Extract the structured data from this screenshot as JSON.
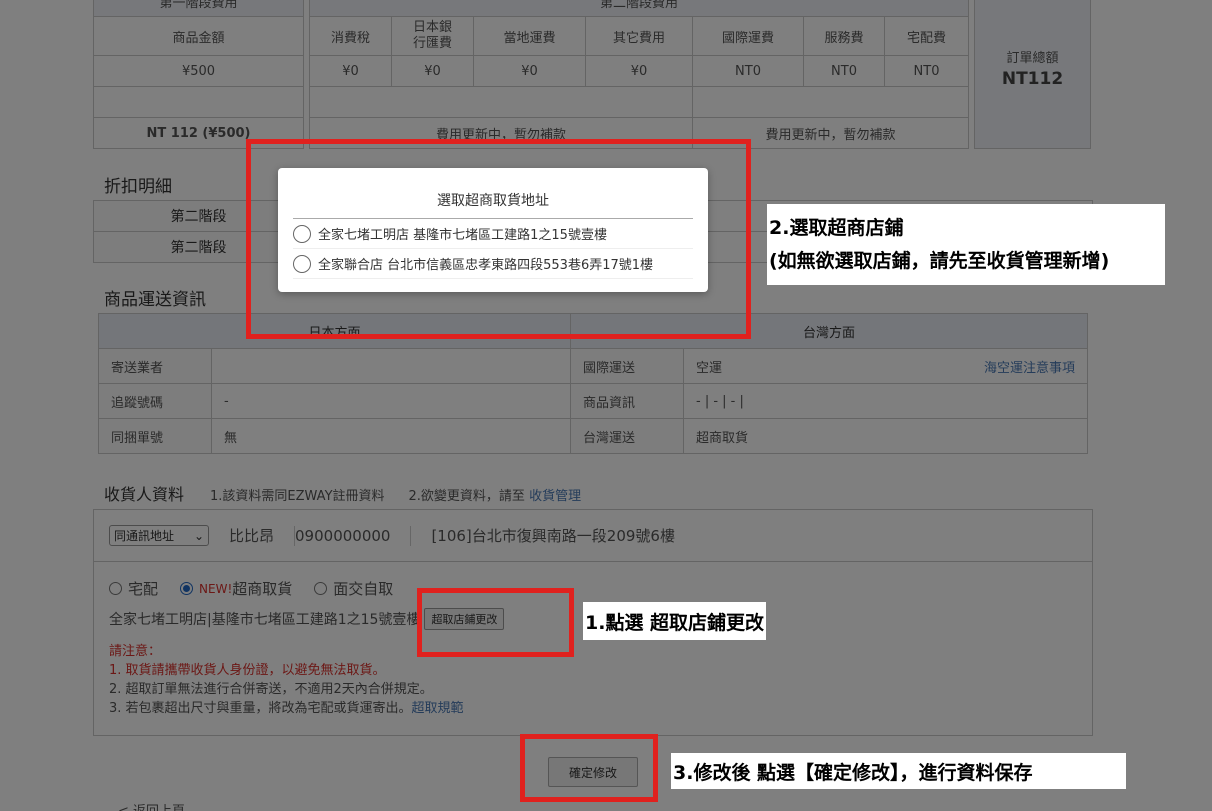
{
  "fees": {
    "stage1_header": "第一階段費用",
    "stage2_header": "第二階段費用",
    "col_goods_amount": "商品金額",
    "col_consumption_tax": "消費稅",
    "col_bank_fee_line1": "日本銀",
    "col_bank_fee_line2": "行匯費",
    "col_local_shipping": "當地運費",
    "col_other_fees": "其它費用",
    "col_intl_shipping": "國際運費",
    "col_service_fee": "服務費",
    "col_delivery_fee": "宅配費",
    "val_goods": "¥500",
    "val_tax": "¥0",
    "val_bank": "¥0",
    "val_local": "¥0",
    "val_other": "¥0",
    "val_intl": "NT0",
    "val_service": "NT0",
    "val_delivery": "NT0",
    "stage1_total": "NT 112 (¥500)",
    "updating_notice": "費用更新中，暫勿補款",
    "order_total_label": "訂單總額",
    "order_total_value": "NT112"
  },
  "discount": {
    "title": "折扣明細",
    "row1": "第二階段",
    "row2": "第二階段"
  },
  "shipping": {
    "title": "商品運送資訊",
    "japan_header": "日本方面",
    "taiwan_header": "台灣方面",
    "carrier_label": "寄送業者",
    "carrier_value": "",
    "tracking_label": "追蹤號碼",
    "tracking_value": "-",
    "combined_label": "同捆單號",
    "combined_value": "無",
    "intl_label": "國際運送",
    "intl_value": "空運",
    "intl_link": "海空運注意事項",
    "goods_info_label": "商品資訊",
    "goods_info_value": "-   |   -   |   -   |",
    "tw_ship_label": "台灣運送",
    "tw_ship_value": "超商取貨"
  },
  "recipient": {
    "title": "收貨人資料",
    "note1": "1.該資料需同EZWAY註冊資料",
    "note2_prefix": "2.欲變更資料，請至",
    "note2_link": "收貨管理",
    "address_select": "同通訊地址",
    "name": "比比昂",
    "phone": "0900000000",
    "address": "[106]台北市復興南路一段209號6樓",
    "opt_home": "宅配",
    "opt_new": "NEW!",
    "opt_cvs": "超商取貨",
    "opt_face": "面交自取",
    "selected_store": "全家七堵工明店|基隆市七堵區工建路1之15號壹樓",
    "change_store_btn": "超取店鋪更改",
    "notice_title": "請注意：",
    "notice1": "1. 取貨請攜帶收貨人身份證，以避免無法取貨。",
    "notice2": "2. 超取訂單無法進行合併寄送，不適用2天內合併規定。",
    "notice3_prefix": "3. 若包裹超出尺寸與重量，將改為宅配或貨運寄出。",
    "notice3_link": "超取規範"
  },
  "confirm_btn": "確定修改",
  "back_link": "< 返回上頁",
  "modal": {
    "title": "選取超商取貨地址",
    "option1": "全家七堵工明店 基隆市七堵區工建路1之15號壹樓",
    "option2": "全家聯合店 台北市信義區忠孝東路四段553巷6弄17號1樓"
  },
  "annotations": {
    "step1": "1.點選 超取店鋪更改",
    "step2_line1": "2.選取超商店鋪",
    "step2_line2": "(如無欲選取店鋪，請先至收貨管理新增)",
    "step3": "3.修改後 點選【確定修改】，進行資料保存"
  },
  "colors": {
    "annotation_red": "#e0211e",
    "notice_red": "#d9302c",
    "link_blue": "#4a79b5"
  }
}
